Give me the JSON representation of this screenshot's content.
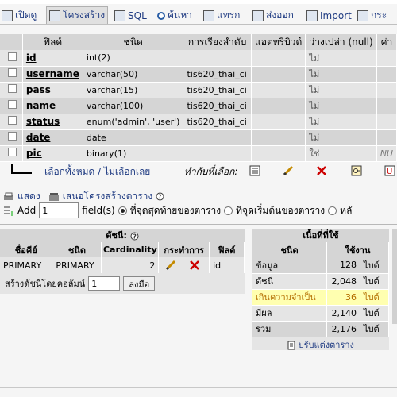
{
  "tabs": [
    {
      "label": "เปิดดู",
      "icon": "browse-icon"
    },
    {
      "label": "โครงสร้าง",
      "icon": "structure-icon"
    },
    {
      "label": "SQL",
      "icon": "sql-icon"
    },
    {
      "label": "ค้นหา",
      "icon": "search-icon"
    },
    {
      "label": "แทรก",
      "icon": "insert-icon"
    },
    {
      "label": "ส่งออก",
      "icon": "export-icon"
    },
    {
      "label": "Import",
      "icon": "import-icon"
    },
    {
      "label": "กระ",
      "icon": "operations-icon"
    }
  ],
  "structure": {
    "headers": [
      "ฟิลด์",
      "ชนิด",
      "การเรียงลำดับ",
      "แอตทริบิวต์",
      "ว่างเปล่า (null)",
      "ค่า"
    ],
    "rows": [
      {
        "field": "id",
        "type": "int(2)",
        "collation": "",
        "attributes": "",
        "null": "ไม่",
        "default": ""
      },
      {
        "field": "username",
        "type": "varchar(50)",
        "collation": "tis620_thai_ci",
        "attributes": "",
        "null": "ไม่",
        "default": ""
      },
      {
        "field": "pass",
        "type": "varchar(15)",
        "collation": "tis620_thai_ci",
        "attributes": "",
        "null": "ไม่",
        "default": ""
      },
      {
        "field": "name",
        "type": "varchar(100)",
        "collation": "tis620_thai_ci",
        "attributes": "",
        "null": "ไม่",
        "default": ""
      },
      {
        "field": "status",
        "type": "enum('admin', 'user')",
        "collation": "tis620_thai_ci",
        "attributes": "",
        "null": "ไม่",
        "default": ""
      },
      {
        "field": "date",
        "type": "date",
        "collation": "",
        "attributes": "",
        "null": "ไม่",
        "default": ""
      },
      {
        "field": "pic",
        "type": "binary(1)",
        "collation": "",
        "attributes": "",
        "null": "ใช่",
        "default": "NU"
      }
    ]
  },
  "actions": {
    "select_all": "เลือกทั้งหมด / ไม่เลือกเลย",
    "with_selected": "ทำกับที่เลือก:"
  },
  "links": {
    "print": "แสดง",
    "propose": "เสนอโครงสร้างตาราง"
  },
  "add": {
    "label": "Add",
    "count": "1",
    "fields": "field(s)",
    "opt_end": "ที่จุดสุดท้ายของตาราง",
    "opt_begin": "ที่จุดเริ่มต้นของตาราง",
    "opt_after": "หลั"
  },
  "indexes": {
    "title": "ดัชนี:",
    "headers": [
      "ชื่อคีย์",
      "ชนิด",
      "Cardinality",
      "กระทำการ",
      "ฟิลด์"
    ],
    "rows": [
      {
        "key": "PRIMARY",
        "type": "PRIMARY",
        "cardinality": "2",
        "field": "id"
      }
    ],
    "create_label": "สร้างดัชนีโดยคอลัมน์",
    "create_value": "1",
    "go": "ลงมือ"
  },
  "space": {
    "title": "เนื้อที่ที่ใช้",
    "headers": [
      "ชนิด",
      "ใช้งาน"
    ],
    "rows": [
      {
        "type": "ข้อมูล",
        "value": "128",
        "unit": "ไบต์"
      },
      {
        "type": "ดัชนี",
        "value": "2,048",
        "unit": "ไบต์"
      },
      {
        "type": "เกินความจำเป็น",
        "value": "36",
        "unit": "ไบต์"
      },
      {
        "type": "มีผล",
        "value": "2,140",
        "unit": "ไบต์"
      },
      {
        "type": "รวม",
        "value": "2,176",
        "unit": "ไบต์"
      }
    ],
    "optimize": "ปรับแต่งตาราง"
  }
}
